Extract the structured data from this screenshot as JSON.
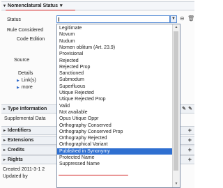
{
  "nomenclatural_status": {
    "header": "Nomenclatural Status",
    "status_label": "Status",
    "rule_considered_label": "Rule Considered",
    "code_edition_label": "Code Edition",
    "source_label": "Source",
    "details_label": "Details",
    "links_label": "Link(s)",
    "more_label": "more",
    "status_value": ""
  },
  "type_information": {
    "header": "Type Information"
  },
  "supplemental_data": {
    "label": "Supplemental Data"
  },
  "identifiers": {
    "header": "Identifiers"
  },
  "extensions": {
    "header": "Extensions"
  },
  "credits": {
    "header": "Credits"
  },
  "rights": {
    "header": "Rights"
  },
  "created": {
    "text": "Created 2011-3-1 2"
  },
  "updated": {
    "label": "Updated by"
  },
  "dropdown": {
    "options": [
      "Legitimate",
      "Novum",
      "Nudum",
      "Nomen oblitum (Art. 23.9)",
      "Provisional",
      "Rejected",
      "Rejected Prop",
      "Sanctioned",
      "Submodum",
      "Superfluous",
      "Utique Rejected",
      "Utique Rejected Prop",
      "Valid",
      "Not available",
      "Opus Utique Oppr",
      "Orthography Conserved",
      "Orthography Conserved Prop",
      "Orthography Rejected",
      "Orthographical Variant",
      "Published in Synonymy",
      "Protected Name",
      "Suppressed Name"
    ],
    "selected": "Published in Synonymy"
  },
  "colors": {
    "selection": "#2f6fd0",
    "annotation_underline": "#d01818",
    "header_background": "#eef1f5"
  }
}
